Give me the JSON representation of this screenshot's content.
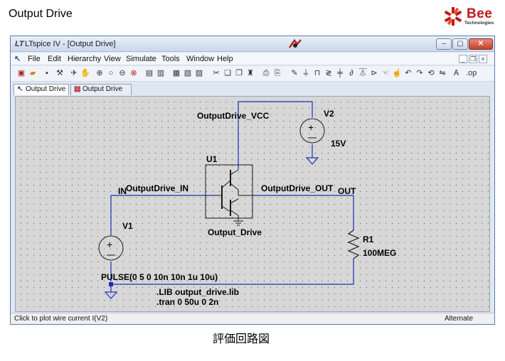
{
  "slide": {
    "title": "Output Drive",
    "caption": "評価回路図",
    "logo": {
      "brand": "Bee",
      "sub": "Technologies"
    }
  },
  "window": {
    "app_glyph": "LT",
    "title": "LTspice IV - [Output Drive]",
    "buttons": {
      "minimize": "‒",
      "maximize": "▢",
      "close": "✕"
    }
  },
  "menu": {
    "items": [
      "File",
      "Edit",
      "Hierarchy",
      "View",
      "Simulate",
      "Tools",
      "Window",
      "Help"
    ],
    "mdi": {
      "minimize": "_",
      "restore": "❐",
      "close": "×"
    }
  },
  "toolbar": {
    "icons": [
      "new-schematic",
      "open",
      "save",
      "control-panel",
      "run",
      "halt",
      "zoom-in",
      "pan",
      "zoom-out",
      "zoom-fit",
      "tile",
      "cascade",
      "wire",
      "ground",
      "label",
      "resistor",
      "capacitor",
      "inductor",
      "diode",
      "component",
      "move",
      "drag",
      "undo",
      "redo",
      "rotate",
      "mirror",
      "text",
      "spice-directive",
      "cut",
      "copy",
      "paste",
      "find",
      "print-setup",
      "print"
    ]
  },
  "tabs": [
    {
      "label": "Output Drive",
      "icon": "schematic-icon",
      "active": true
    },
    {
      "label": "Output Drive",
      "icon": "waveform-icon",
      "active": false
    }
  ],
  "schematic": {
    "net_vcc": "OutputDrive_VCC",
    "net_in": "OutputDrive_IN",
    "net_out": "OutputDrive_OUT",
    "port_in": "IN",
    "port_out": "OUT",
    "v2_name": "V2",
    "v2_value": "15V",
    "u1_name": "U1",
    "u1_value": "Output_Drive",
    "v1_name": "V1",
    "v1_value": "PULSE(0 5 0 10n 10n 1u 10u)",
    "r1_name": "R1",
    "r1_value": "100MEG",
    "directive_lib": ".LIB output_drive.lib",
    "directive_tran": ".tran 0 50u 0 2n",
    "wire_color": "#1f2fb8"
  },
  "status": {
    "left": "Click to plot wire current I(V2)",
    "right": "Alternate"
  }
}
